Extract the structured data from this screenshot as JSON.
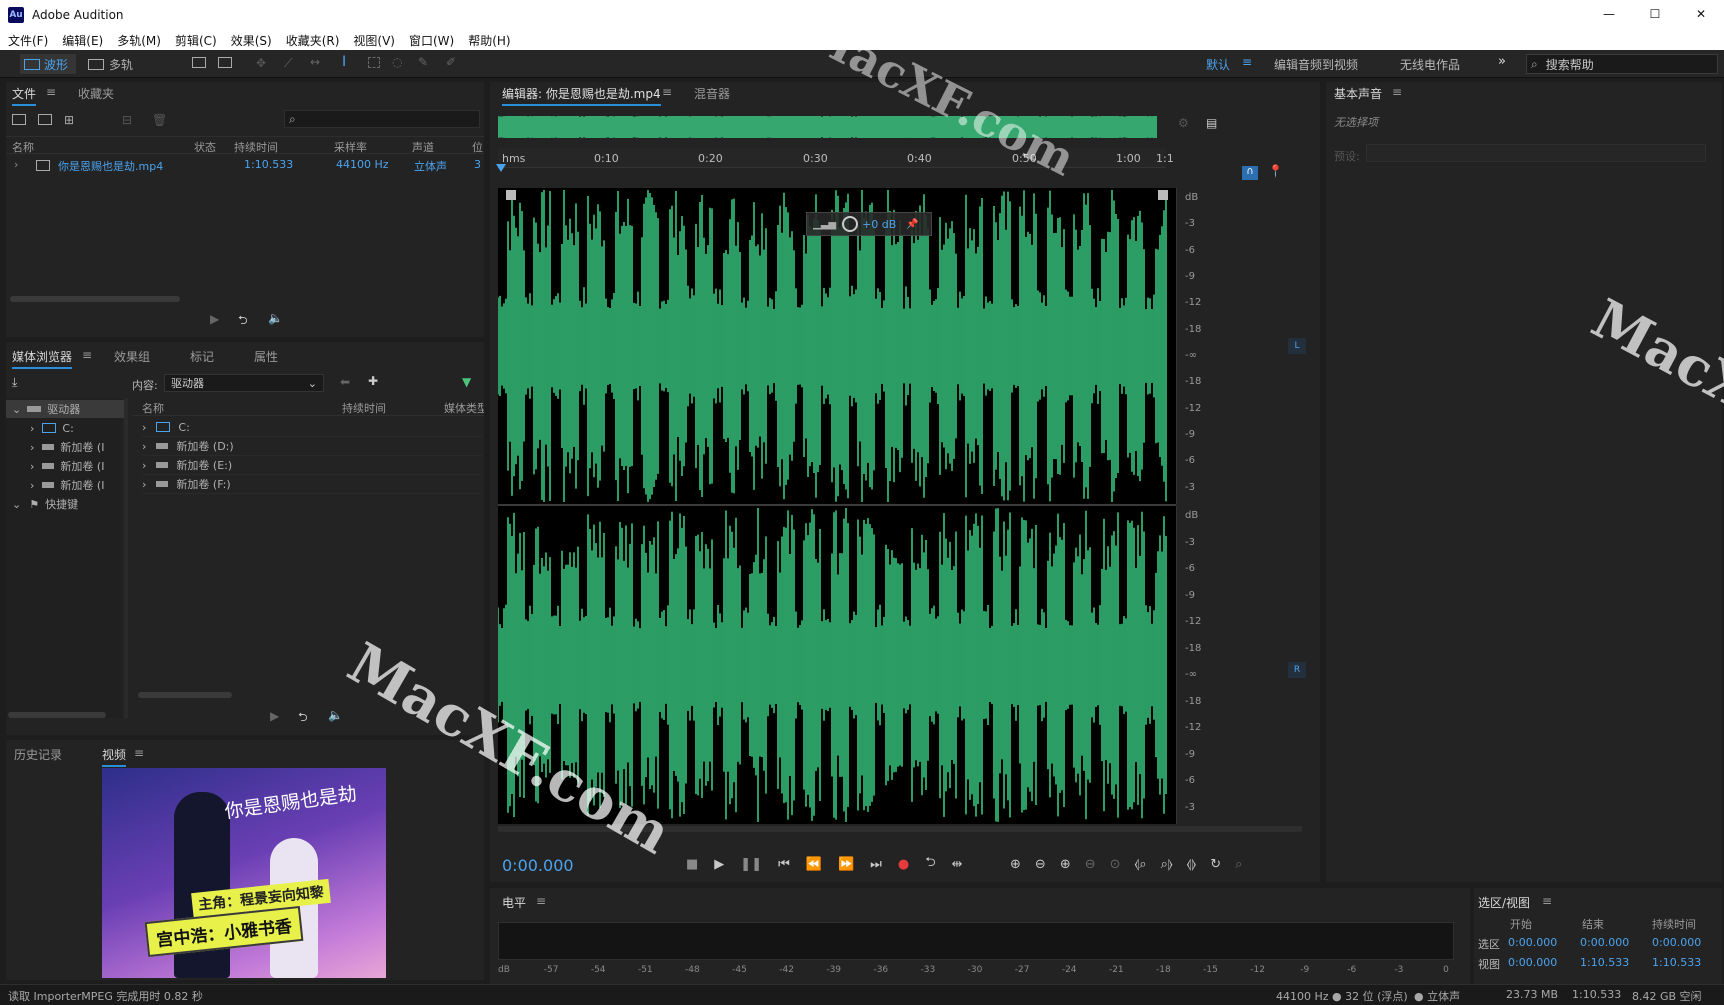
{
  "app": {
    "title": "Adobe Audition",
    "logo": "Au",
    "window_controls": [
      "—",
      "☐",
      "✕"
    ]
  },
  "menu": [
    "文件(F)",
    "编辑(E)",
    "多轨(M)",
    "剪辑(C)",
    "效果(S)",
    "收藏夹(R)",
    "视图(V)",
    "窗口(W)",
    "帮助(H)"
  ],
  "toolbar": {
    "waveform_label": "波形",
    "multitrack_label": "多轨",
    "workspaces": [
      "默认",
      "编辑音频到视频",
      "无线电作品"
    ],
    "search_placeholder": "搜索帮助"
  },
  "files_panel": {
    "tabs": [
      "文件",
      "收藏夹"
    ],
    "columns": [
      "名称",
      "状态",
      "持续时间",
      "采样率",
      "声道",
      "位"
    ],
    "file": {
      "name": "你是恩赐也是劫.mp4",
      "duration": "1:10.533",
      "sample_rate": "44100 Hz",
      "channels": "立体声",
      "bits": "3"
    }
  },
  "media_panel": {
    "tabs": [
      "媒体浏览器",
      "效果组",
      "标记",
      "属性"
    ],
    "content_label": "内容:",
    "content_value": "驱动器",
    "tree": [
      "驱动器",
      "C:",
      "新加卷 (I",
      "新加卷 (I",
      "新加卷 (I",
      "快捷键"
    ],
    "columns": [
      "名称",
      "持续时间",
      "媒体类型"
    ],
    "rows": [
      "C:",
      "新加卷 (D:)",
      "新加卷 (E:)",
      "新加卷 (F:)"
    ]
  },
  "bottom_left_panel": {
    "tabs": [
      "历史记录",
      "视频"
    ],
    "video": {
      "title": "你是恩赐也是劫",
      "banner1": "主角：程景妄向知黎",
      "banner2": "宫中浩：小雅书香"
    }
  },
  "editor": {
    "tab": "编辑器: 你是恩赐也是劫.mp4",
    "mixer_tab": "混音器",
    "ruler": [
      "hms",
      "0:10",
      "0:20",
      "0:30",
      "0:40",
      "0:50",
      "1:00",
      "1:1"
    ],
    "hud_gain": "+0 dB",
    "db_scale": [
      "dB",
      "-3",
      "-6",
      "-9",
      "-12",
      "-18",
      "-∞",
      "-18",
      "-12",
      "-9",
      "-6",
      "-3"
    ],
    "channel_left": "L",
    "channel_right": "R",
    "timecode": "0:00.000",
    "waveform_color": "#3ee090"
  },
  "essential_sound": {
    "title": "基本声音",
    "no_selection": "无选择项",
    "preset_label": "预设:"
  },
  "levels": {
    "title": "电平",
    "ticks": [
      "dB",
      "-57",
      "-54",
      "-51",
      "-48",
      "-45",
      "-42",
      "-39",
      "-36",
      "-33",
      "-30",
      "-27",
      "-24",
      "-21",
      "-18",
      "-15",
      "-12",
      "-9",
      "-6",
      "-3",
      "0"
    ]
  },
  "selection_view": {
    "title": "选区/视图",
    "headers": [
      "开始",
      "结束",
      "持续时间"
    ],
    "rows": [
      {
        "label": "选区",
        "start": "0:00.000",
        "end": "0:00.000",
        "duration": "0:00.000"
      },
      {
        "label": "视图",
        "start": "0:00.000",
        "end": "1:10.533",
        "duration": "1:10.533"
      }
    ]
  },
  "status_bar": {
    "message": "读取 ImporterMPEG 完成用时 0.82 秒",
    "format": "44100 Hz ● 32 位 (浮点)",
    "channels": "● 立体声",
    "size": "23.73 MB",
    "duration": "1:10.533",
    "free": "8.42 GB 空闲"
  },
  "watermark": "MacXF.com"
}
